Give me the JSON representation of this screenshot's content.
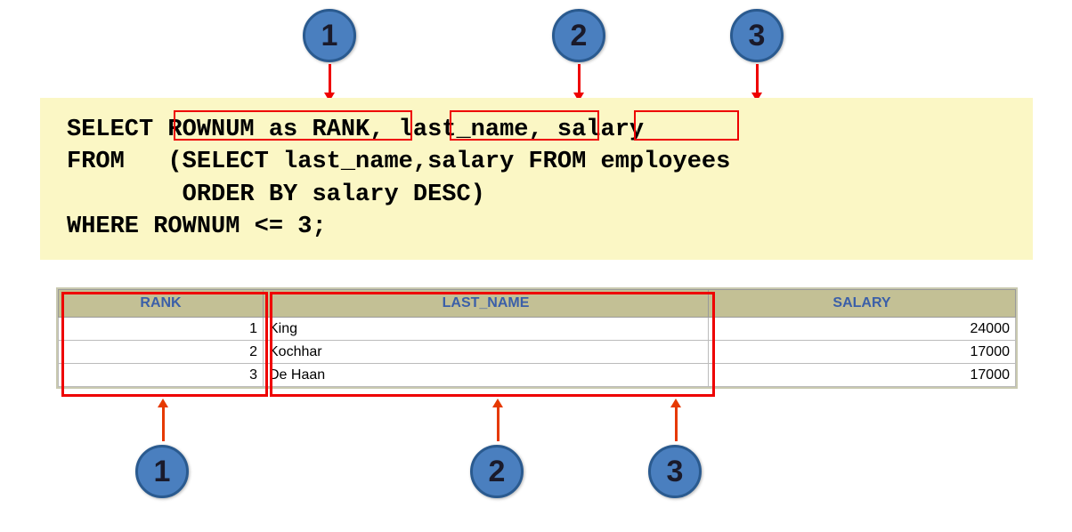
{
  "badges_top": [
    "1",
    "2",
    "3"
  ],
  "badges_bottom": [
    "1",
    "2",
    "3"
  ],
  "sql": {
    "line1a": "SELECT ",
    "hl1": "ROWNUM as RANK",
    "line1b": ", ",
    "hl2": "last_name",
    "line1c": ", ",
    "hl3": "salary",
    "line2": "FROM   (SELECT last_name,salary FROM employees",
    "line3": "        ORDER BY salary DESC)",
    "line4": "WHERE ROWNUM <= 3;"
  },
  "table": {
    "headers": [
      "RANK",
      "LAST_NAME",
      "SALARY"
    ],
    "rows": [
      {
        "rank": "1",
        "last_name": "King",
        "salary": "24000"
      },
      {
        "rank": "2",
        "last_name": "Kochhar",
        "salary": "17000"
      },
      {
        "rank": "3",
        "last_name": "De Haan",
        "salary": "17000"
      }
    ]
  },
  "chart_data": {
    "type": "table",
    "title": "Top 3 salaries using ROWNUM",
    "columns": [
      "RANK",
      "LAST_NAME",
      "SALARY"
    ],
    "rows": [
      [
        1,
        "King",
        24000
      ],
      [
        2,
        "Kochhar",
        17000
      ],
      [
        3,
        "De Haan",
        17000
      ]
    ]
  }
}
